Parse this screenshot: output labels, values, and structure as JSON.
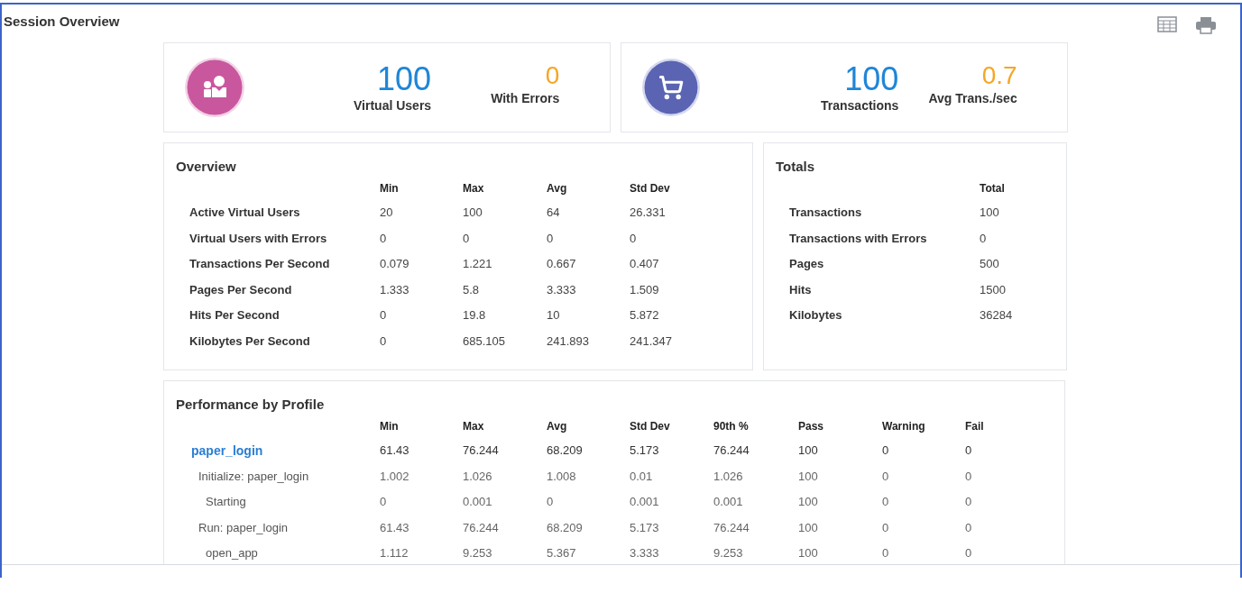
{
  "title": "Session Overview",
  "summary_cards": [
    {
      "kind": "users",
      "value": "100",
      "label": "Virtual Users",
      "secondary_value": "0",
      "secondary_label": "With Errors"
    },
    {
      "kind": "transactions",
      "value": "100",
      "label": "Transactions",
      "secondary_value": "0.7",
      "secondary_label": "Avg Trans./sec"
    }
  ],
  "overview": {
    "title": "Overview",
    "columns": [
      "Min",
      "Max",
      "Avg",
      "Std Dev"
    ],
    "rows": [
      {
        "label": "Active Virtual Users",
        "values": [
          "20",
          "100",
          "64",
          "26.331"
        ]
      },
      {
        "label": "Virtual Users with Errors",
        "values": [
          "0",
          "0",
          "0",
          "0"
        ]
      },
      {
        "label": "Transactions Per Second",
        "values": [
          "0.079",
          "1.221",
          "0.667",
          "0.407"
        ]
      },
      {
        "label": "Pages Per Second",
        "values": [
          "1.333",
          "5.8",
          "3.333",
          "1.509"
        ]
      },
      {
        "label": "Hits Per Second",
        "values": [
          "0",
          "19.8",
          "10",
          "5.872"
        ]
      },
      {
        "label": "Kilobytes Per Second",
        "values": [
          "0",
          "685.105",
          "241.893",
          "241.347"
        ]
      }
    ]
  },
  "totals": {
    "title": "Totals",
    "columns": [
      "Total"
    ],
    "rows": [
      {
        "label": "Transactions",
        "values": [
          "100"
        ]
      },
      {
        "label": "Transactions with Errors",
        "values": [
          "0"
        ]
      },
      {
        "label": "Pages",
        "values": [
          "500"
        ]
      },
      {
        "label": "Hits",
        "values": [
          "1500"
        ]
      },
      {
        "label": "Kilobytes",
        "values": [
          "36284"
        ]
      }
    ]
  },
  "performance": {
    "title": "Performance by Profile",
    "columns": [
      "Min",
      "Max",
      "Avg",
      "Std Dev",
      "90th %",
      "Pass",
      "Warning",
      "Fail"
    ],
    "rows": [
      {
        "kind": "profile",
        "label": "paper_login",
        "values": [
          "61.43",
          "76.244",
          "68.209",
          "5.173",
          "76.244",
          "100",
          "0",
          "0"
        ],
        "children": [
          {
            "kind": "step",
            "label": "Initialize: paper_login",
            "values": [
              "1.002",
              "1.026",
              "1.008",
              "0.01",
              "1.026",
              "100",
              "0",
              "0"
            ],
            "children": [
              {
                "kind": "step",
                "label": "Starting",
                "values": [
                  "0",
                  "0.001",
                  "0",
                  "0.001",
                  "0.001",
                  "100",
                  "0",
                  "0"
                ]
              }
            ]
          },
          {
            "kind": "step",
            "label": "Run: paper_login",
            "values": [
              "61.43",
              "76.244",
              "68.209",
              "5.173",
              "76.244",
              "100",
              "0",
              "0"
            ],
            "children": [
              {
                "kind": "step",
                "label": "open_app",
                "values": [
                  "1.112",
                  "9.253",
                  "5.367",
                  "3.333",
                  "9.253",
                  "100",
                  "0",
                  "0"
                ]
              }
            ]
          }
        ]
      }
    ]
  }
}
